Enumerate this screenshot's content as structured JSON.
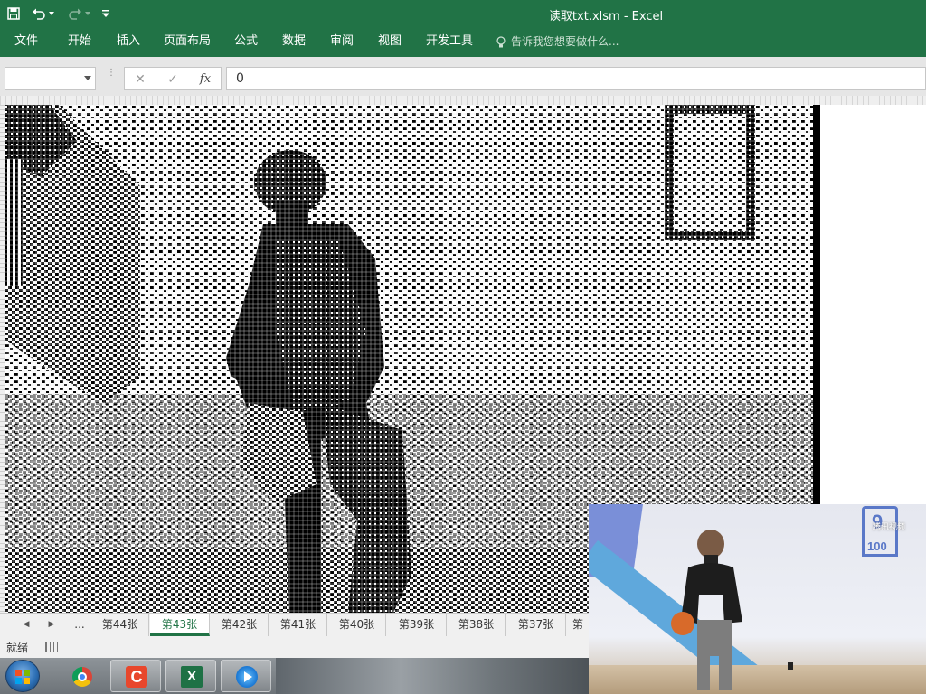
{
  "window": {
    "title": "读取txt.xlsm - Excel"
  },
  "quick_access": {
    "icons": [
      "save-icon",
      "undo-icon",
      "undo-dropdown-icon",
      "redo-icon",
      "redo-dropdown-icon",
      "customize-icon"
    ]
  },
  "ribbon": {
    "tabs": [
      {
        "label": "文件"
      },
      {
        "label": "开始"
      },
      {
        "label": "插入"
      },
      {
        "label": "页面布局"
      },
      {
        "label": "公式"
      },
      {
        "label": "数据"
      },
      {
        "label": "审阅"
      },
      {
        "label": "视图"
      },
      {
        "label": "开发工具"
      }
    ],
    "tell_me": "告诉我您想要做什么..."
  },
  "formula_bar": {
    "name_box": "",
    "cancel": "✕",
    "enter": "✓",
    "fx": "fx",
    "value": "0"
  },
  "sheets": {
    "more": "...",
    "tabs": [
      {
        "label": "第44张",
        "active": false
      },
      {
        "label": "第43张",
        "active": true
      },
      {
        "label": "第42张",
        "active": false
      },
      {
        "label": "第41张",
        "active": false
      },
      {
        "label": "第40张",
        "active": false
      },
      {
        "label": "第39张",
        "active": false
      },
      {
        "label": "第38张",
        "active": false
      },
      {
        "label": "第37张",
        "active": false
      },
      {
        "label": "第",
        "active": false
      }
    ]
  },
  "status_bar": {
    "text": "就绪"
  },
  "taskbar": {
    "apps": [
      "windows-start-icon",
      "chrome-icon",
      "capcut-icon",
      "excel-icon",
      "media-player-icon"
    ]
  },
  "video_overlay": {
    "logo_number": "100",
    "logo_mark": "9",
    "watermark": "腾讯视频"
  },
  "colors": {
    "excel_green": "#217346",
    "active_tab": "#217346",
    "pixel_black": "#000000",
    "pixel_white": "#ffffff"
  }
}
